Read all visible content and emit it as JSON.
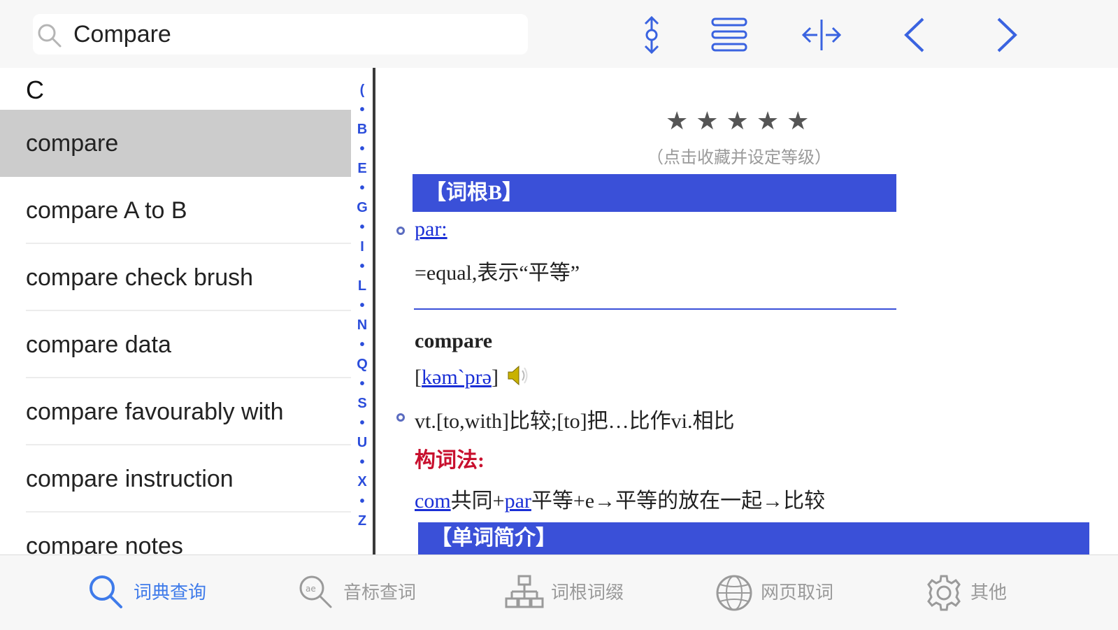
{
  "search": {
    "value": "Compare"
  },
  "word_list": {
    "section_header": "C",
    "items": [
      {
        "label": "compare",
        "selected": true
      },
      {
        "label": "compare A to B",
        "selected": false
      },
      {
        "label": "compare check brush",
        "selected": false
      },
      {
        "label": "compare data",
        "selected": false
      },
      {
        "label": "compare favourably with",
        "selected": false
      },
      {
        "label": "compare instruction",
        "selected": false
      },
      {
        "label": "compare notes",
        "selected": false
      }
    ]
  },
  "index_bar": [
    "(",
    "•",
    "B",
    "•",
    "E",
    "•",
    "G",
    "•",
    "I",
    "•",
    "L",
    "•",
    "N",
    "•",
    "Q",
    "•",
    "S",
    "•",
    "U",
    "•",
    "X",
    "•",
    "Z"
  ],
  "entry": {
    "stars": "★★★★★",
    "rating_hint": "（点击收藏并设定等级）",
    "root_header": "【词根B】",
    "root_link": "par:",
    "root_meaning": "=equal,表示“平等”",
    "headword": "compare",
    "phonetic_open": "[",
    "phonetic": "kəm`prə",
    "phonetic_close": "]",
    "definition": "vt.[to,with]比较;[to]把…比作vi.相比",
    "formation_label": "构词法:",
    "formation_link1": "com",
    "formation_part1": "共同+",
    "formation_link2": "par",
    "formation_part2": "平等+e→平等的放在一起→比较",
    "intro_header": "【单词简介】"
  },
  "tabbar": {
    "tabs": [
      {
        "label": "词典查询",
        "icon": "search-icon",
        "active": true
      },
      {
        "label": "音标查词",
        "icon": "phonetic-search-icon",
        "active": false
      },
      {
        "label": "词根词缀",
        "icon": "tree-icon",
        "active": false
      },
      {
        "label": "网页取词",
        "icon": "globe-icon",
        "active": false
      },
      {
        "label": "其他",
        "icon": "gear-icon",
        "active": false
      }
    ]
  },
  "colors": {
    "accent": "#3f7bea",
    "band": "#3a50d8",
    "link": "#1a2fd6",
    "red": "#c8102e",
    "selected_row": "#cccccc"
  }
}
